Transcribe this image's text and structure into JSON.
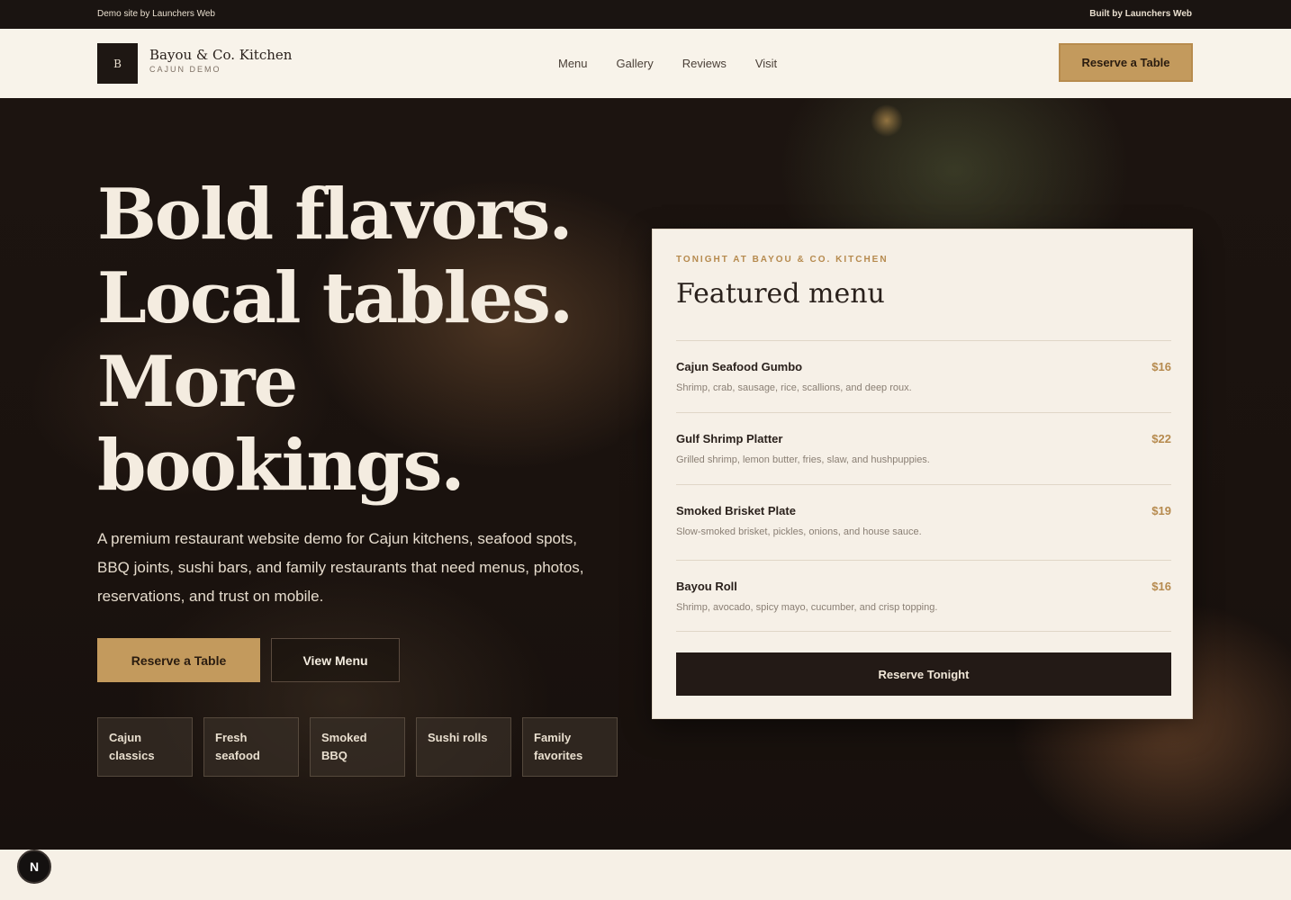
{
  "topbar": {
    "left_text": "Demo site by Launchers Web",
    "right_text": "Built by Launchers Web"
  },
  "header": {
    "logo_mark": "B",
    "brand_name": "Bayou & Co. Kitchen",
    "brand_sub": "CAJUN DEMO",
    "nav": [
      "Menu",
      "Gallery",
      "Reviews",
      "Visit"
    ],
    "cta": "Reserve a Table"
  },
  "hero": {
    "title_lines": [
      "Bold flavors.",
      "Local tables.",
      "More",
      "bookings."
    ],
    "description": "A premium restaurant website demo for Cajun kitchens, seafood spots, BBQ joints, sushi bars, and family restaurants that need menus, photos, reservations, and trust on mobile.",
    "primary_button": "Reserve a Table",
    "secondary_button": "View Menu",
    "chips": [
      "Cajun classics",
      "Fresh seafood",
      "Smoked BBQ",
      "Sushi rolls",
      "Family favorites"
    ]
  },
  "featured_menu": {
    "eyebrow": "TONIGHT AT BAYOU & CO. KITCHEN",
    "title": "Featured menu",
    "items": [
      {
        "name": "Cajun Seafood Gumbo",
        "price": "$16",
        "desc": "Shrimp, crab, sausage, rice, scallions, and deep roux."
      },
      {
        "name": "Gulf Shrimp Platter",
        "price": "$22",
        "desc": "Grilled shrimp, lemon butter, fries, slaw, and hushpuppies."
      },
      {
        "name": "Smoked Brisket Plate",
        "price": "$19",
        "desc": "Slow-smoked brisket, pickles, onions, and house sauce."
      },
      {
        "name": "Bayou Roll",
        "price": "$16",
        "desc": "Shrimp, avocado, spicy mayo, cucumber, and crisp topping."
      }
    ],
    "button": "Reserve Tonight"
  },
  "badge": {
    "label": "N"
  }
}
